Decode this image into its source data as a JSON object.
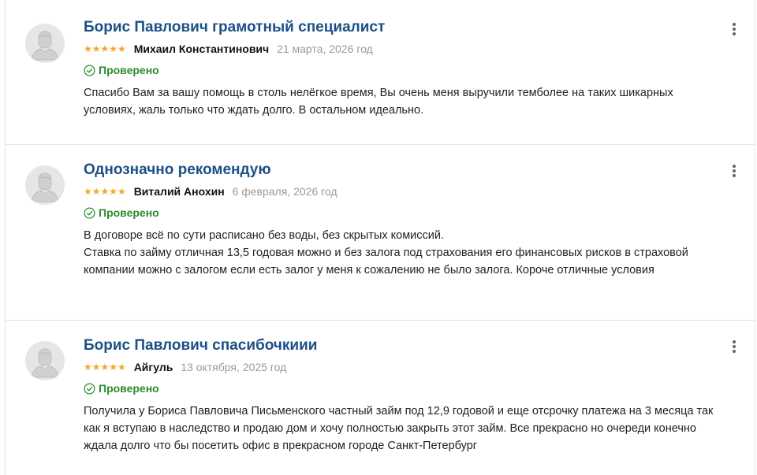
{
  "reviews": [
    {
      "title": "Борис Павлович грамотный специалист",
      "stars": "★★★★★",
      "rating": 5,
      "author": "Михаил Константинович",
      "date": "21 марта, 2026 год",
      "verified_label": "Проверено",
      "body": [
        "Спасибо Вам за вашу помощь в столь нелёгкое время, Вы очень меня выручили темболее на таких шикарных условиях, жаль только что ждать долго. В остальном идеально."
      ]
    },
    {
      "title": "Однозначно рекомендую",
      "stars": "★★★★★",
      "rating": 5,
      "author": "Виталий Анохин",
      "date": "6 февраля, 2026 год",
      "verified_label": "Проверено",
      "body": [
        "В договоре всё по сути расписано без воды, без скрытых комиссий.",
        "Ставка по займу отличная 13,5 годовая можно и без залога под страхования его финансовых рисков в страховой компании можно с залогом если есть залог у меня к сожалению не было залога. Короче отличные условия"
      ]
    },
    {
      "title": "Борис Павлович спасибочкиии",
      "stars": "★★★★★",
      "rating": 5,
      "author": "Айгуль",
      "date": "13 октября, 2025 год",
      "verified_label": "Проверено",
      "body": [
        "Получила у Бориса Павловича Письменского частный займ под 12,9 годовой и еще отсрочку платежа на 3 месяца так как я вступаю в наследство и продаю дом и хочу полностью закрыть этот займ. Все прекрасно но очереди конечно ждала долго что бы посетить офис в прекрасном городе Санкт-Петербург"
      ]
    }
  ],
  "icons": {
    "avatar": "user-avatar-icon",
    "verified": "check-circle-icon",
    "more": "more-vertical-icon"
  },
  "colors": {
    "title": "#1d4f86",
    "stars": "#f5a623",
    "verified": "#2d8a2d",
    "date": "#9a9a9a"
  }
}
